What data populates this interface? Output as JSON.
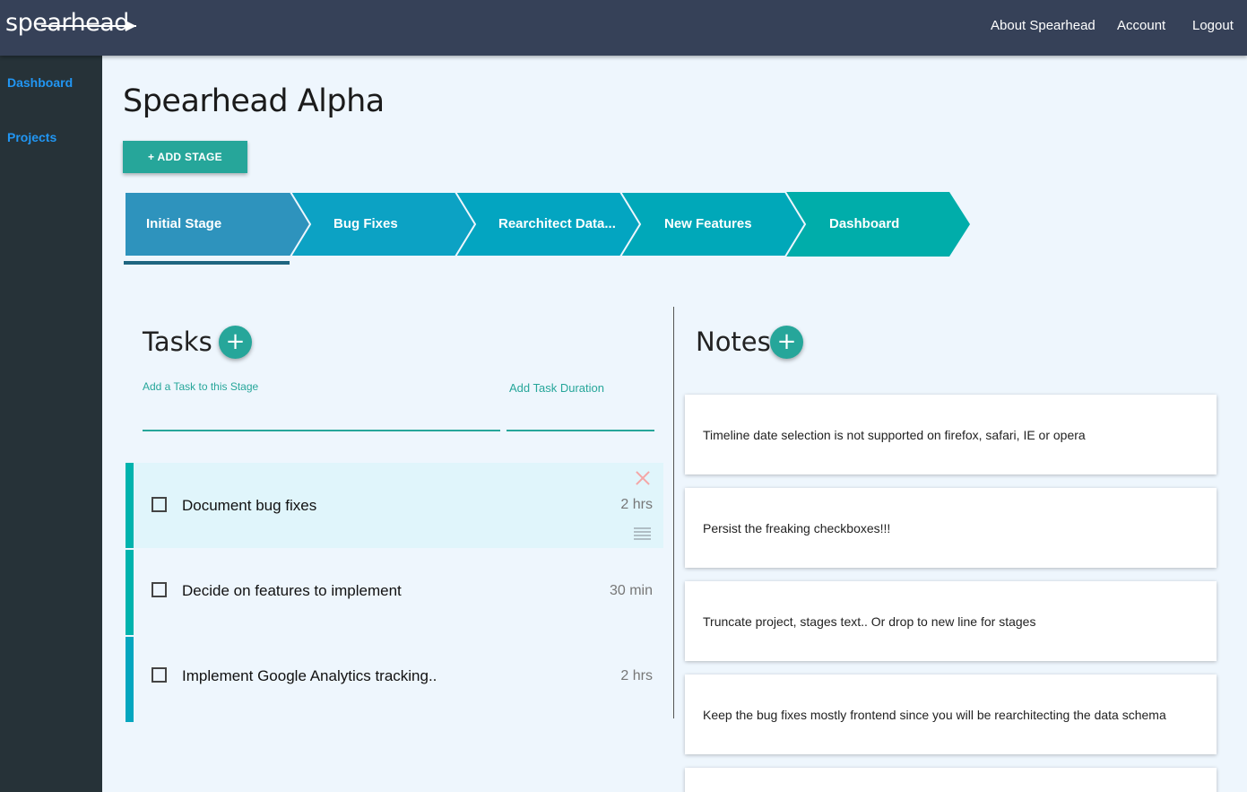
{
  "header": {
    "logo_text": "spearhead",
    "nav": [
      "About Spearhead",
      "Account",
      "Logout"
    ]
  },
  "sidebar": {
    "items": [
      {
        "label": "Dashboard"
      },
      {
        "label": "Projects"
      }
    ]
  },
  "page": {
    "title": "Spearhead Alpha",
    "add_stage_label": "+ ADD STAGE"
  },
  "stages": [
    {
      "label": "Initial Stage",
      "color": "#2e93bd",
      "active": true
    },
    {
      "label": "Bug Fixes",
      "color": "#0ca2c4"
    },
    {
      "label": "Rearchitect Data...",
      "color": "#03a5c1"
    },
    {
      "label": "New Features",
      "color": "#00a8b9"
    },
    {
      "label": "Dashboard",
      "color": "#00adaa"
    }
  ],
  "tasks_section": {
    "title": "Tasks",
    "add_icon": "+",
    "task_field_label": "Add a Task to this Stage",
    "duration_field_label": "Add Task Duration",
    "items": [
      {
        "text": "Document bug fixes",
        "duration": "2 hrs",
        "bar_color": "#00b3ad",
        "active": true
      },
      {
        "text": "Decide on features to implement",
        "duration": "30 min",
        "bar_color": "#00b3ad"
      },
      {
        "text": "Implement Google Analytics tracking..",
        "duration": "2 hrs",
        "bar_color": "#04a6bf"
      }
    ]
  },
  "notes_section": {
    "title": "Notes",
    "add_icon": "+",
    "items": [
      {
        "text": "Timeline date selection is not supported on firefox, safari, IE or opera"
      },
      {
        "text": "Persist the freaking checkboxes!!!"
      },
      {
        "text": "Truncate project, stages text.. Or drop to new line for stages"
      },
      {
        "text": "Keep the bug fixes mostly frontend since you will be rearchitecting the data schema"
      }
    ]
  },
  "colors": {
    "topbar": "#364158",
    "sidebar": "#263238",
    "accent": "#26a69a",
    "link": "#2196f3",
    "background": "#eef6fd"
  }
}
